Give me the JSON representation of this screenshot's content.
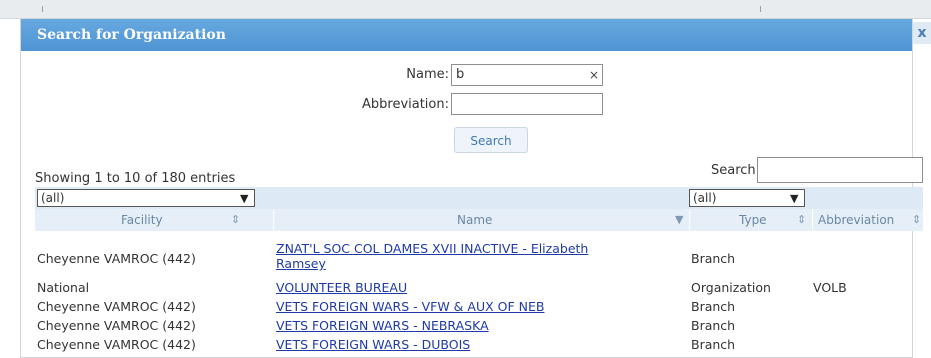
{
  "dialog": {
    "title": "Search for Organization",
    "close_glyph": "x"
  },
  "form": {
    "name_label": "Name:",
    "name_value": "b",
    "clear_glyph": "×",
    "abbr_label": "Abbreviation:",
    "abbr_value": "",
    "search_button": "Search"
  },
  "table": {
    "info": "Showing 1 to 10 of 180 entries",
    "search_label": "Search:",
    "search_value": "",
    "filters": {
      "facility": "(all)",
      "type": "(all)"
    },
    "columns": [
      "Facility",
      "Name",
      "Type",
      "Abbreviation"
    ],
    "rows": [
      {
        "facility": "Cheyenne VAMROC (442)",
        "name_line1": "ZNAT'L SOC COL DAMES XVII INACTIVE - Elizabeth",
        "name_line2": "Ramsey",
        "type": "Branch",
        "abbr": ""
      },
      {
        "facility": "National",
        "name_line1": "VOLUNTEER BUREAU",
        "name_line2": "",
        "type": "Organization",
        "abbr": "VOLB"
      },
      {
        "facility": "Cheyenne VAMROC (442)",
        "name_line1": "VETS FOREIGN WARS - VFW & AUX OF NEB",
        "name_line2": "",
        "type": "Branch",
        "abbr": ""
      },
      {
        "facility": "Cheyenne VAMROC (442)",
        "name_line1": "VETS FOREIGN WARS - NEBRASKA",
        "name_line2": "",
        "type": "Branch",
        "abbr": ""
      },
      {
        "facility": "Cheyenne VAMROC (442)",
        "name_line1": "VETS FOREIGN WARS - DUBOIS",
        "name_line2": "",
        "type": "Branch",
        "abbr": ""
      }
    ]
  },
  "colors": {
    "titlebar": "#5b9fd9",
    "link": "#1f3aa8",
    "header_bg": "#e6eff8",
    "filter_bg": "#ddeaf6"
  }
}
